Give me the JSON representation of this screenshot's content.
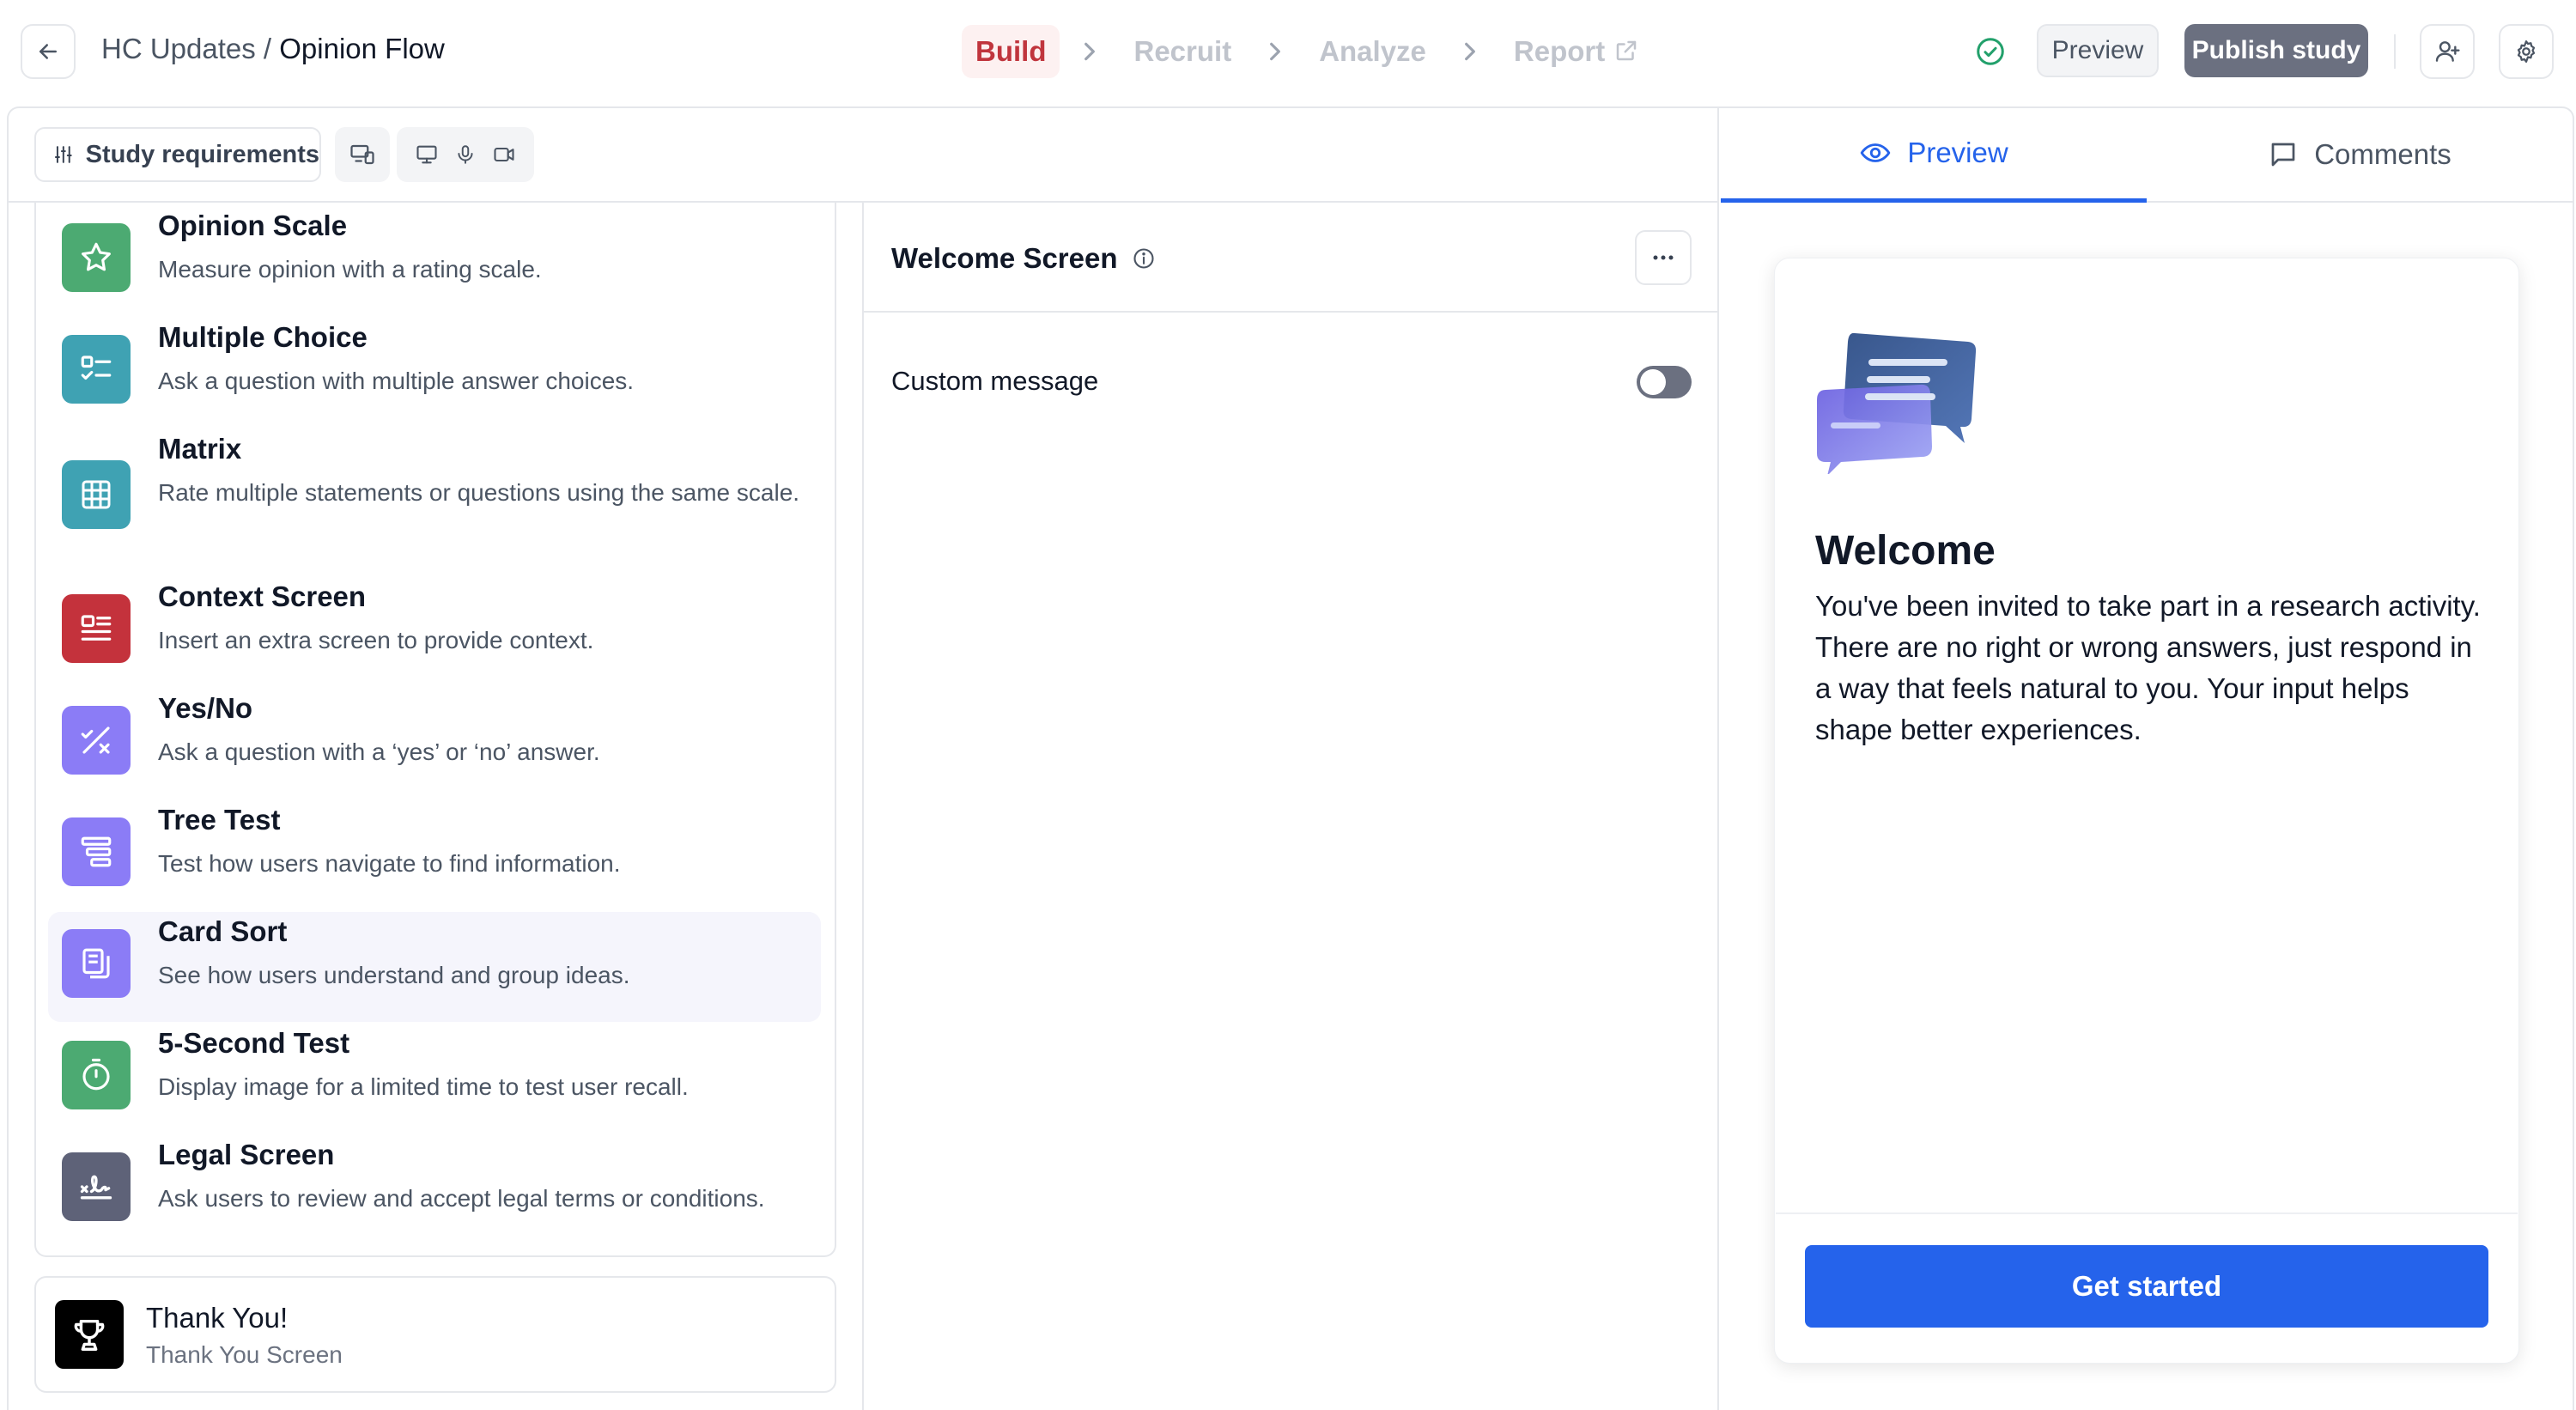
{
  "header": {
    "breadcrumb_parent": "HC Updates",
    "breadcrumb_sep": " / ",
    "breadcrumb_current": "Opinion Flow",
    "steps": [
      "Build",
      "Recruit",
      "Analyze",
      "Report"
    ],
    "active_step": "Build",
    "preview_label": "Preview",
    "publish_label": "Publish study"
  },
  "toolbar": {
    "requirements_label": "Study requirements",
    "chips": [
      [
        "devices-icon"
      ],
      [
        "desktop-icon",
        "microphone-icon",
        "camera-icon"
      ]
    ]
  },
  "blocks": [
    {
      "title": "Opinion Scale",
      "desc": "Measure opinion with a rating scale.",
      "color": "#4caa72",
      "icon": "star-icon"
    },
    {
      "title": "Multiple Choice",
      "desc": "Ask a question with multiple answer choices.",
      "color": "#3fa2b3",
      "icon": "checklist-icon"
    },
    {
      "title": "Matrix",
      "desc": "Rate multiple statements or questions using the same scale.",
      "color": "#3fa2b3",
      "icon": "grid-icon"
    },
    {
      "title": "Context Screen",
      "desc": "Insert an extra screen to provide context.",
      "color": "#c4323c",
      "icon": "context-icon"
    },
    {
      "title": "Yes/No",
      "desc": "Ask a question with a ‘yes’ or ‘no’ answer.",
      "color": "#8b7cf6",
      "icon": "yes-no-icon"
    },
    {
      "title": "Tree Test",
      "desc": "Test how users navigate to find information.",
      "color": "#8b7cf6",
      "icon": "tree-icon"
    },
    {
      "title": "Card Sort",
      "desc": "See how users understand and group ideas.",
      "color": "#8b7cf6",
      "icon": "cards-icon"
    },
    {
      "title": "5-Second Test",
      "desc": "Display image for a limited time to test user recall.",
      "color": "#4caa72",
      "icon": "timer-icon"
    },
    {
      "title": "Legal Screen",
      "desc": "Ask users to review and accept legal terms or conditions.",
      "color": "#5e6278",
      "icon": "signature-icon"
    }
  ],
  "highlighted_block": "Card Sort",
  "thank_you": {
    "title": "Thank You!",
    "subtitle": "Thank You Screen"
  },
  "editor": {
    "title": "Welcome Screen",
    "custom_message_label": "Custom message",
    "custom_message_enabled": false
  },
  "right_tabs": {
    "preview": "Preview",
    "comments": "Comments",
    "active": "Preview"
  },
  "preview_card": {
    "title": "Welcome",
    "body": "You've been invited to take part in a research activity. There are no right or wrong answers, just respond in a way that feels natural to you. Your input helps shape better experiences.",
    "cta": "Get started"
  },
  "colors": {
    "accent": "#2563eb",
    "active_step": "#c0353d",
    "publish": "#6b7080",
    "success": "#22a06b"
  }
}
